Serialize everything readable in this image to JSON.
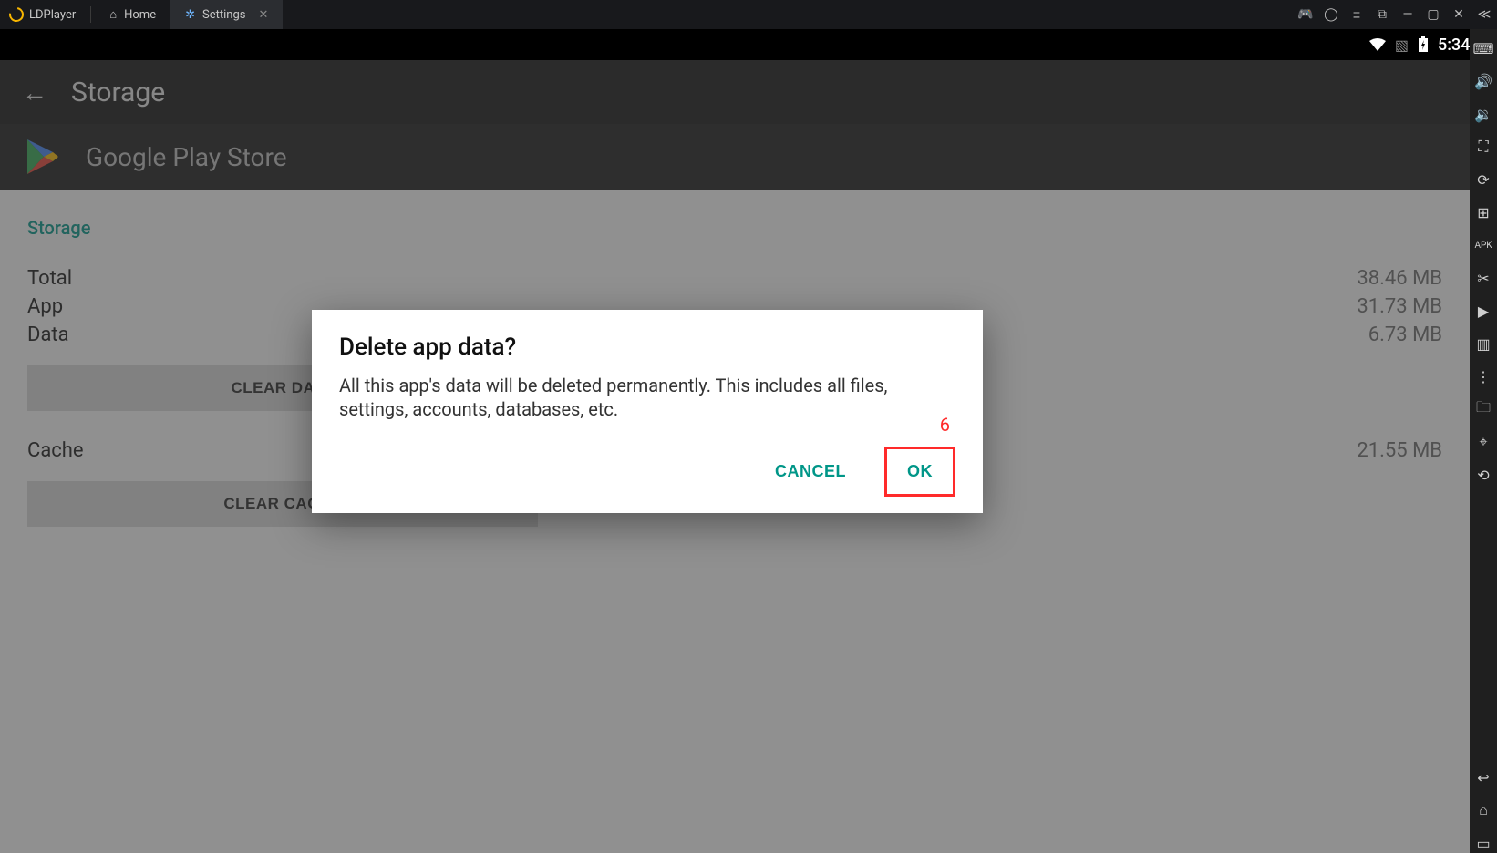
{
  "titlebar": {
    "brand": "LDPlayer",
    "tabs": [
      {
        "label": "Home",
        "active": false
      },
      {
        "label": "Settings",
        "active": true
      }
    ]
  },
  "statusbar": {
    "time": "5:34"
  },
  "header": {
    "title": "Storage"
  },
  "app": {
    "name": "Google Play Store"
  },
  "storage": {
    "section_label": "Storage",
    "rows": {
      "total_label": "Total",
      "total_value": "38.46 MB",
      "app_label": "App",
      "app_value": "31.73 MB",
      "data_label": "Data",
      "data_value": "6.73 MB",
      "cache_label": "Cache",
      "cache_value": "21.55 MB"
    },
    "clear_data_label": "CLEAR DATA",
    "clear_cache_label": "CLEAR CACHE"
  },
  "dialog": {
    "title": "Delete app data?",
    "body": "All this app's data will be deleted permanently. This includes all files, settings, accounts, databases, etc.",
    "cancel": "CANCEL",
    "ok": "OK",
    "annotation": "6"
  }
}
